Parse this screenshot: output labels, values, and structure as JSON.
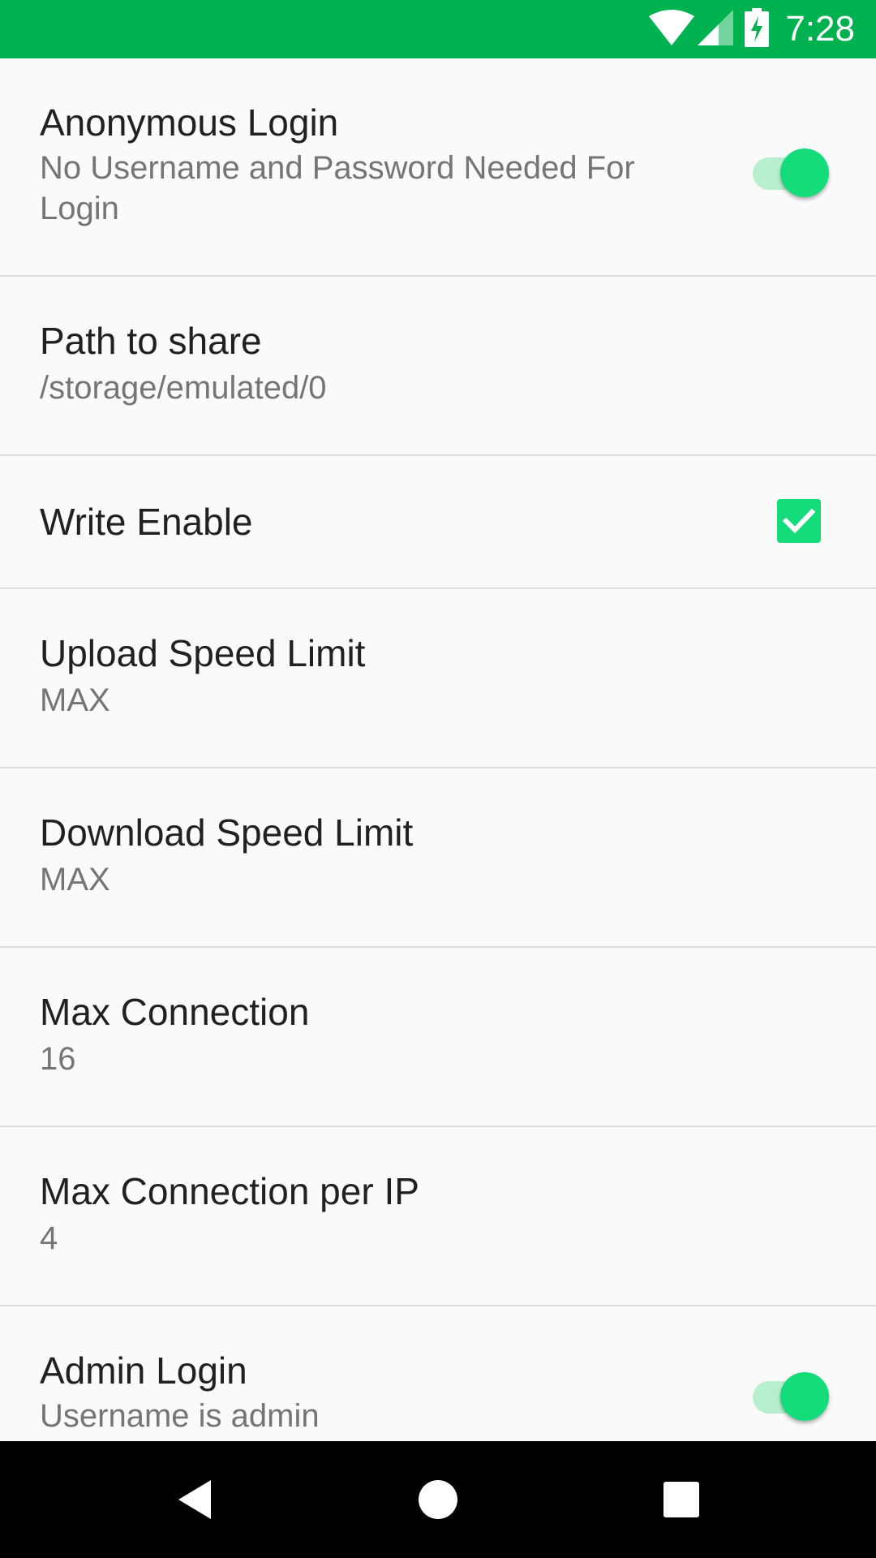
{
  "status_bar": {
    "time": "7:28",
    "icons": [
      "wifi-icon",
      "cell-signal-icon",
      "battery-charging-icon"
    ],
    "color": "#00b14f"
  },
  "settings": [
    {
      "title": "Anonymous Login",
      "summary": "No Username and Password Needed For Login",
      "control": "switch",
      "checked": true
    },
    {
      "title": "Path to share",
      "summary": "/storage/emulated/0"
    },
    {
      "title": "Write Enable",
      "control": "checkbox",
      "checked": true
    },
    {
      "title": "Upload Speed Limit",
      "summary": "MAX"
    },
    {
      "title": "Download Speed Limit",
      "summary": "MAX"
    },
    {
      "title": "Max Connection",
      "summary": "16"
    },
    {
      "title": "Max Connection per IP",
      "summary": "4"
    },
    {
      "title": "Admin Login",
      "summary": "Username is admin",
      "control": "switch",
      "checked": true
    }
  ],
  "nav_bar": {
    "buttons": [
      "back-icon",
      "home-icon",
      "recents-icon"
    ]
  },
  "colors": {
    "accent": "#14dc7b",
    "accent_track": "#b8f0cf",
    "title_text": "#212121",
    "summary_text": "#757575"
  }
}
